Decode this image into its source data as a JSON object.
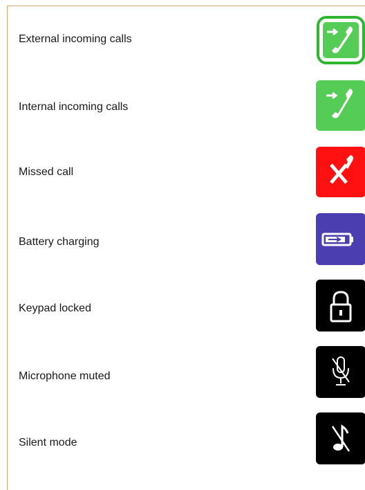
{
  "status_icons": [
    {
      "label": "External incoming calls",
      "icon": "external-incoming-call-icon",
      "color": "#55cc55"
    },
    {
      "label": "Internal incoming calls",
      "icon": "internal-incoming-call-icon",
      "color": "#55cc55"
    },
    {
      "label": "Missed call",
      "icon": "missed-call-icon",
      "color": "#ff1111"
    },
    {
      "label": "Battery charging",
      "icon": "battery-charging-icon",
      "color": "#4a3eb0"
    },
    {
      "label": "Keypad locked",
      "icon": "keypad-locked-icon",
      "color": "#000000"
    },
    {
      "label": "Microphone muted",
      "icon": "microphone-muted-icon",
      "color": "#000000"
    },
    {
      "label": "Silent mode",
      "icon": "silent-mode-icon",
      "color": "#000000"
    }
  ]
}
